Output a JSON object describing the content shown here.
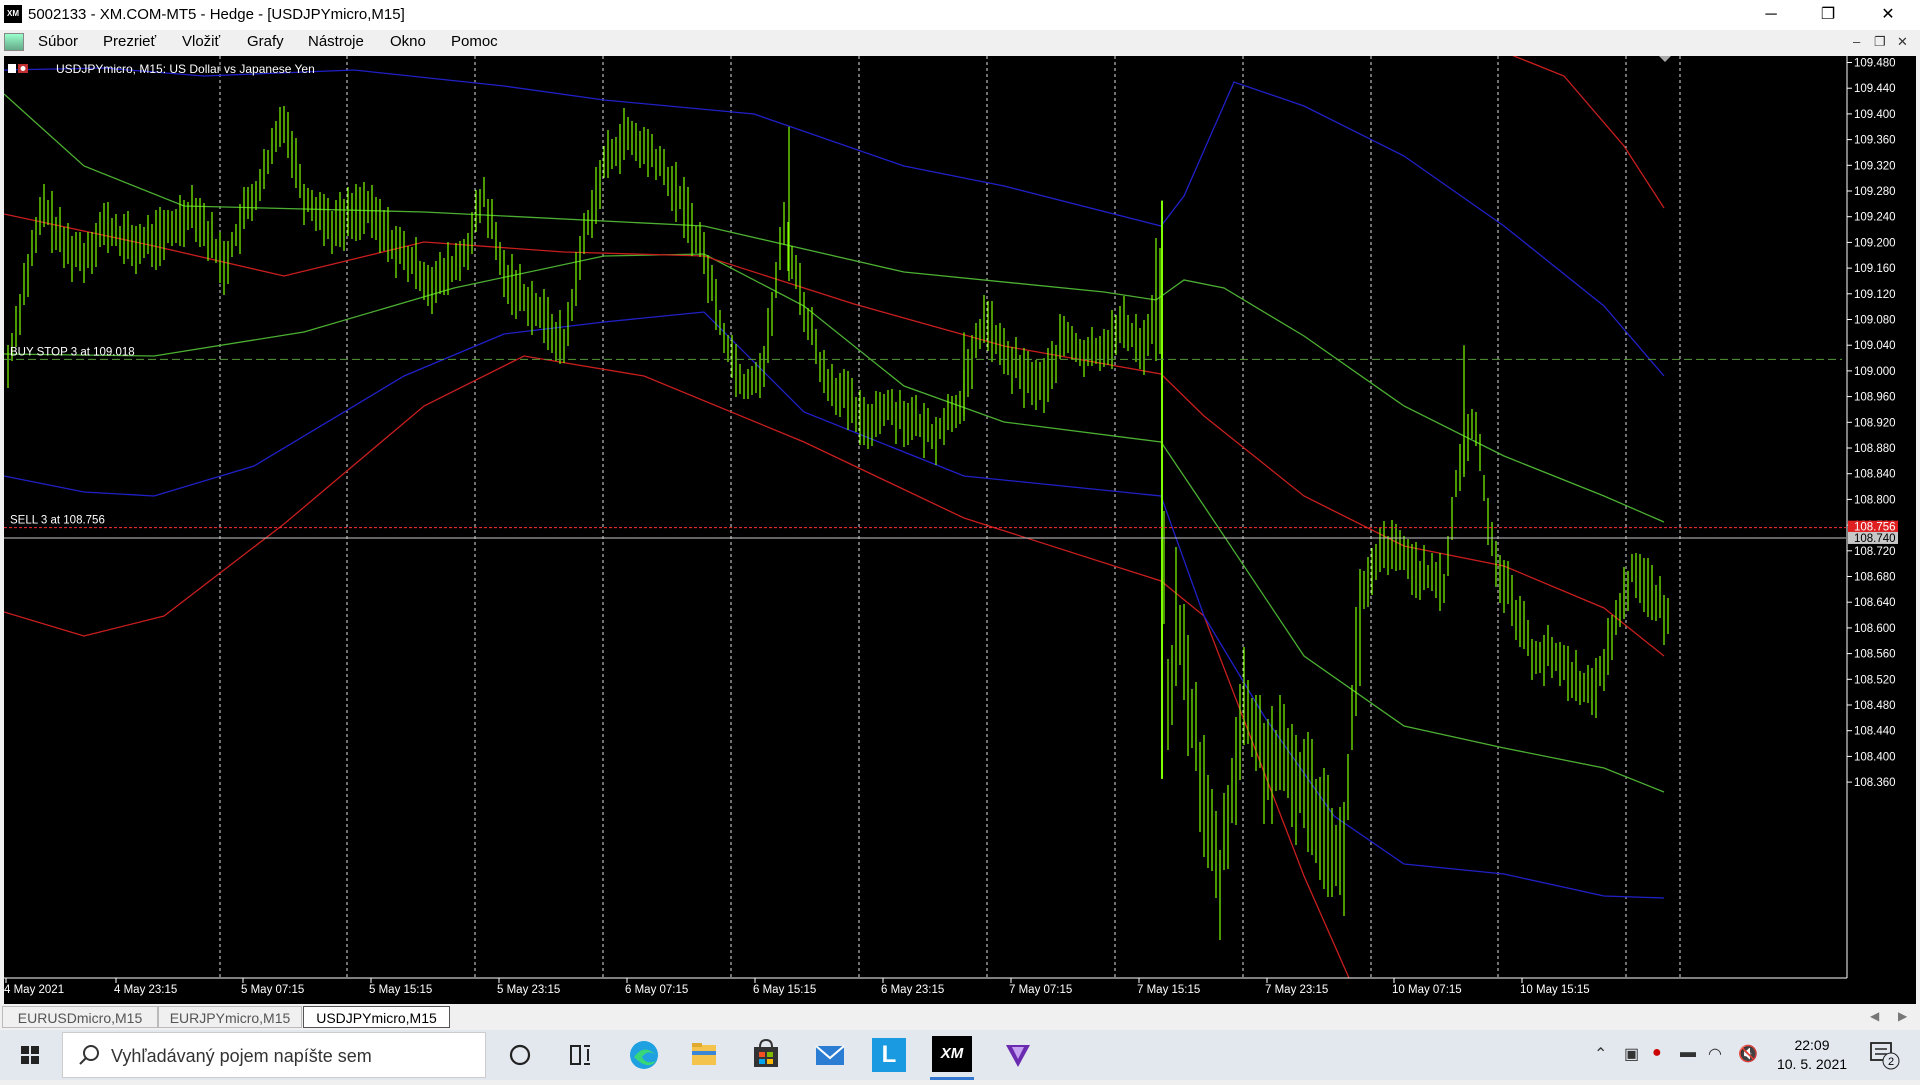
{
  "window": {
    "title": "5002133 - XM.COM-MT5 - Hedge - [USDJPYmicro,M15]",
    "app_icon_text": "XM",
    "minimize": "─",
    "restore": "❐",
    "close": "✕"
  },
  "menu": {
    "items": [
      "Súbor",
      "Prezrieť",
      "Vložiť",
      "Grafy",
      "Nástroje",
      "Okno",
      "Pomoc"
    ],
    "mdi_minimize": "‒",
    "mdi_restore": "❐",
    "mdi_close": "✕"
  },
  "chart": {
    "symbol_label": "USDJPYmicro, M15:  US Dollar vs Japanese Yen",
    "price_labels": [
      "109.480",
      "109.440",
      "109.400",
      "109.360",
      "109.320",
      "109.280",
      "109.240",
      "109.200",
      "109.160",
      "109.120",
      "109.080",
      "109.040",
      "109.000",
      "108.960",
      "108.920",
      "108.880",
      "108.840",
      "108.800",
      "108.760",
      "108.720",
      "108.680",
      "108.640",
      "108.600",
      "108.560",
      "108.520",
      "108.480",
      "108.440",
      "108.400",
      "108.360"
    ],
    "time_labels": [
      "4 May 2021",
      "4 May 23:15",
      "5 May 07:15",
      "5 May 15:15",
      "5 May 23:15",
      "6 May 07:15",
      "6 May 15:15",
      "6 May 23:15",
      "7 May 07:15",
      "7 May 15:15",
      "7 May 23:15",
      "10 May 07:15",
      "10 May 15:15"
    ],
    "buy_stop_label": "BUY STOP 3 at 109.018",
    "buy_stop_price": 109.018,
    "sell_label": "SELL 3 at 108.756",
    "sell_price": 108.756,
    "ask_label": "108.756",
    "bid_label": "108.740",
    "bid_price": 108.74,
    "colors": {
      "background": "#000000",
      "candles": "#7fff00",
      "band_green": "#4caf32",
      "band_red": "#c81e1e",
      "band_blue": "#2020c8",
      "buy_stop_line": "#5a9a3a",
      "sell_line": "#ff3030",
      "bid_line": "#c8c8c8"
    }
  },
  "tabs": [
    "EURUSDmicro,M15",
    "EURJPYmicro,M15",
    "USDJPYmicro,M15"
  ],
  "active_tab": "USDJPYmicro,M15",
  "taskbar": {
    "search_placeholder": "Vyhľadávaný pojem napíšte sem",
    "time": "22:09",
    "date": "10. 5. 2021",
    "notification_count": "2",
    "apps": [
      "cortana-icon",
      "task-view-icon",
      "edge-icon",
      "file-explorer-icon",
      "store-icon",
      "mail-icon",
      "l-app-icon",
      "xm-icon",
      "vivaldi-icon"
    ],
    "xm_label": "XM",
    "l_label": "L"
  }
}
